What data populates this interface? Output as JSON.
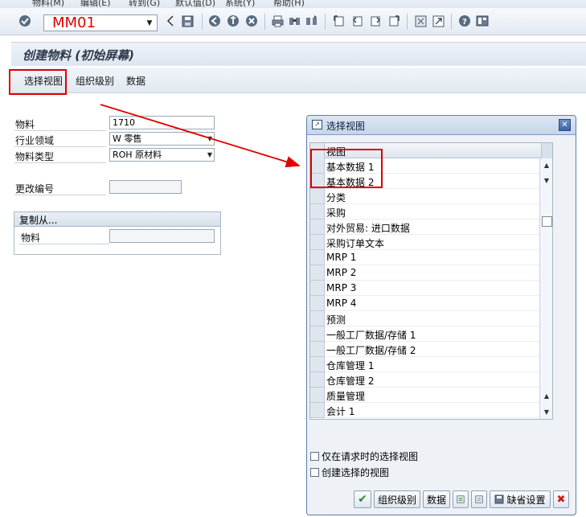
{
  "menu": {
    "items": [
      "物料(M)",
      "编辑(E)",
      "转到(G)",
      "默认值(D)",
      "系统(Y)",
      "帮助(H)"
    ]
  },
  "toolbar": {
    "command_value": "MM01",
    "icons": [
      "check-icon",
      "back-arrow-icon",
      "save-icon",
      "back-icon",
      "exit-icon",
      "cancel-icon",
      "print-icon",
      "find-icon",
      "find-next-icon",
      "first-page-icon",
      "prev-page-icon",
      "next-page-icon",
      "last-page-icon",
      "new-session-icon",
      "shortcut-icon",
      "help-icon",
      "layout-icon"
    ]
  },
  "page": {
    "title": "创建物料 (初始屏幕)"
  },
  "app_toolbar": {
    "select_views": "选择视图",
    "org_levels": "组织级别",
    "data": "数据"
  },
  "form": {
    "material_label": "物料",
    "material_value": "1710",
    "industry_label": "行业领域",
    "industry_value": "W 零售",
    "type_label": "物料类型",
    "type_value": "ROH 原材料",
    "change_label": "更改编号",
    "change_value": "",
    "copy_from": {
      "title": "复制从...",
      "material_label": "物料",
      "material_value": ""
    }
  },
  "dialog": {
    "title": "选择视图",
    "column_header": "视图",
    "views": [
      "基本数据 1",
      "基本数据 2",
      "分类",
      "采购",
      "对外贸易: 进口数据",
      "采购订单文本",
      "MRP 1",
      "MRP 2",
      "MRP 3",
      "MRP 4",
      "预测",
      "一般工厂数据/存储 1",
      "一般工厂数据/存储 2",
      "仓库管理 1",
      "仓库管理 2",
      "质量管理",
      "会计 1"
    ],
    "option_only_on_request": "仅在请求时的选择视图",
    "option_create_selected": "创建选择的视图",
    "buttons": {
      "org_levels": "组织级别",
      "data": "数据",
      "default_values": "缺省设置"
    }
  },
  "colors": {
    "annotation_red": "#e00000",
    "toolbar_bg": "#e3eaf3",
    "dialog_border": "#5d7ea6"
  }
}
